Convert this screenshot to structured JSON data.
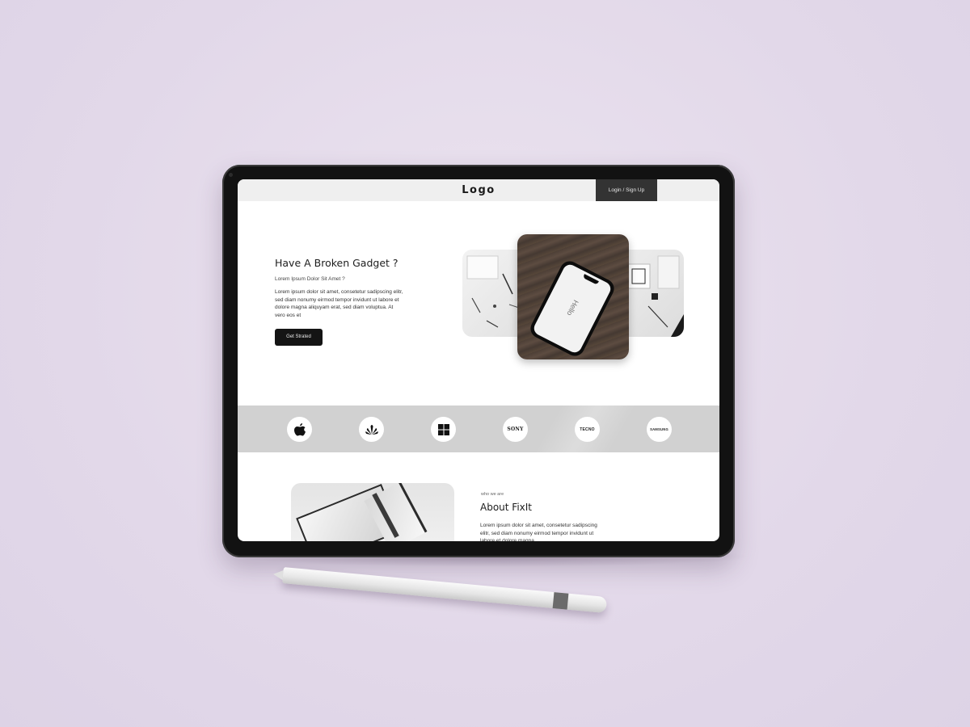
{
  "header": {
    "logo": "Logo",
    "login_label": "Login / Sign Up"
  },
  "hero": {
    "title": "Have A Broken Gadget ?",
    "subtitle": "Lorem Ipsum Dolor Sit Amet ?",
    "body": "Lorem ipsum dolor sit amet, consetetur sadipscing elitr, sed diam nonumy eirmod tempor invidunt ut labore et dolore magna aliquyam erat, sed diam voluptua. At vero eos et",
    "cta_label": "Get Strated",
    "phone_screen_text": "Hello"
  },
  "brands": [
    {
      "name": "apple",
      "label": ""
    },
    {
      "name": "huawei",
      "label": ""
    },
    {
      "name": "windows",
      "label": ""
    },
    {
      "name": "sony",
      "label": "SONY"
    },
    {
      "name": "tecno",
      "label": "TECNO"
    },
    {
      "name": "samsung",
      "label": "SAMSUNG"
    }
  ],
  "about": {
    "small_label": "who we are",
    "title": "About FixIt",
    "body": "Lorem ipsum dolor sit amet, consetetur sadipscing elitr, sed diam nonumy eirmod tempor invidunt ut labore et dolore magna"
  },
  "colors": {
    "background": "#e2d8e9",
    "header_bg": "#efefef",
    "login_bg": "#333333",
    "cta_bg": "#141414",
    "brand_strip_bg": "#d1d1d1",
    "tablet_bezel": "#121212"
  },
  "icons": [
    "apple-icon",
    "huawei-icon",
    "windows-icon",
    "sony-logo",
    "tecno-logo",
    "samsung-logo"
  ]
}
